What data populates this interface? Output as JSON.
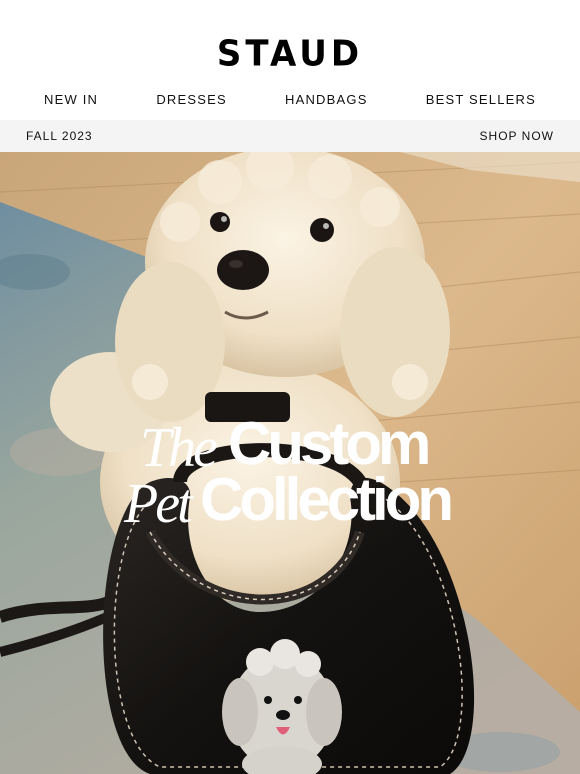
{
  "brand": {
    "logo": "STAUD"
  },
  "nav": {
    "items": [
      {
        "label": "NEW IN"
      },
      {
        "label": "DRESSES"
      },
      {
        "label": "HANDBAGS"
      },
      {
        "label": "BEST SELLERS"
      }
    ]
  },
  "promo": {
    "season": "FALL 2023",
    "cta": "SHOP NOW",
    "background": "#f4f4f4"
  },
  "hero": {
    "title_script_1": "The",
    "title_bold_1": "Custom",
    "title_script_2": "Pet",
    "title_bold_2": "Collection",
    "title_color": "#ffffff",
    "image_description_icon": "dog-with-bag-image"
  }
}
